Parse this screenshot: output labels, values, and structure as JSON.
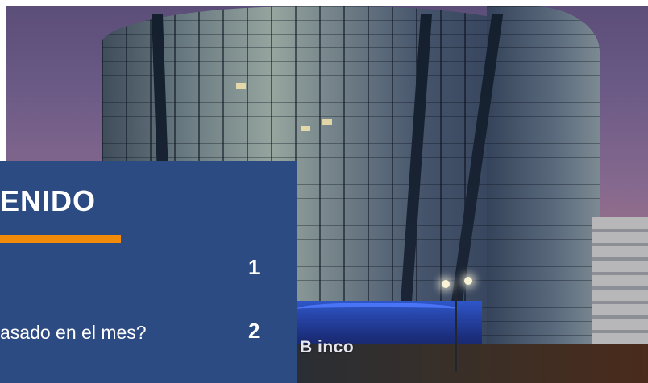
{
  "document": {
    "toc": {
      "heading": "ENIDO",
      "entries": [
        {
          "text": "",
          "page": "1"
        },
        {
          "text": "asado en el mes?",
          "page": "2"
        },
        {
          "text": "",
          "page": ""
        }
      ]
    },
    "cover_photo": {
      "sign_text": "B inco"
    }
  },
  "colors": {
    "panel_background": "#2d4b83",
    "accent_underline": "#f28a0a",
    "panel_text": "#ffffff"
  }
}
